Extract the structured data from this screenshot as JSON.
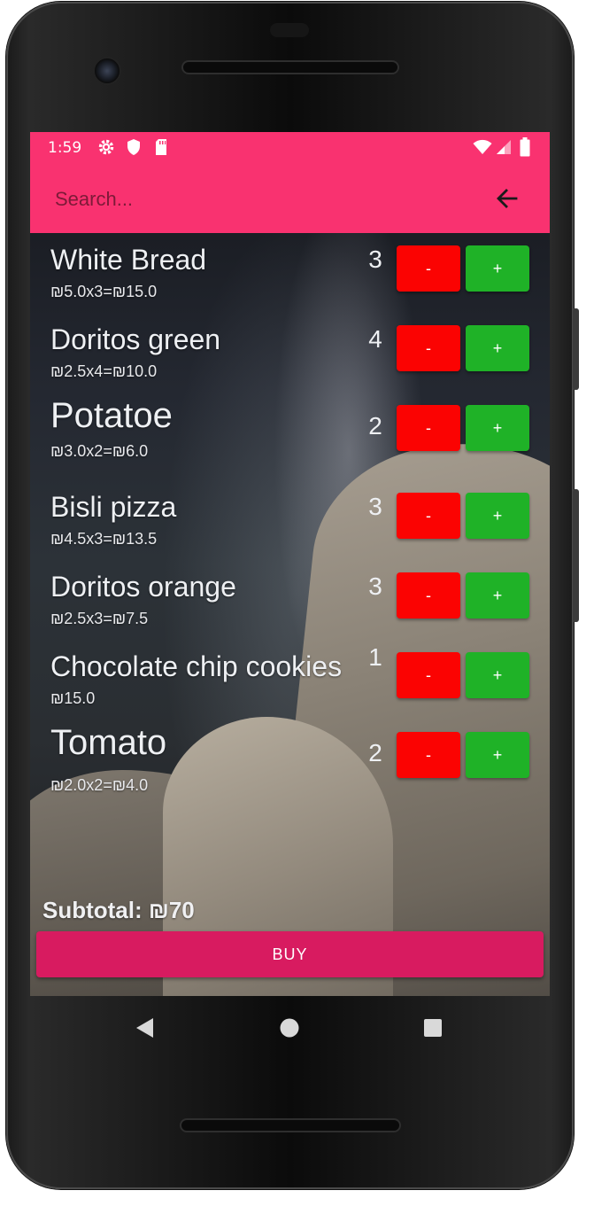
{
  "status_bar": {
    "time": "1:59",
    "icons": [
      "gear-icon",
      "shield-icon",
      "sd-card-icon",
      "wifi-icon",
      "signal-icon",
      "battery-icon"
    ]
  },
  "toolbar": {
    "search_placeholder": "Search...",
    "back_icon": "arrow-left-icon"
  },
  "cart": {
    "items": [
      {
        "name": "White Bread",
        "calc": "₪5.0x3=₪15.0",
        "qty": "3",
        "minus": "-",
        "plus": "+"
      },
      {
        "name": "Doritos green",
        "calc": "₪2.5x4=₪10.0",
        "qty": "4",
        "minus": "-",
        "plus": "+"
      },
      {
        "name": "Potatoe",
        "calc": "₪3.0x2=₪6.0",
        "qty": "2",
        "minus": "-",
        "plus": "+"
      },
      {
        "name": "Bisli pizza",
        "calc": "₪4.5x3=₪13.5",
        "qty": "3",
        "minus": "-",
        "plus": "+"
      },
      {
        "name": "Doritos orange",
        "calc": "₪2.5x3=₪7.5",
        "qty": "3",
        "minus": "-",
        "plus": "+"
      },
      {
        "name": "Chocolate chip cookies",
        "calc": "₪15.0",
        "qty": "1",
        "minus": "-",
        "plus": "+"
      },
      {
        "name": "Tomato",
        "calc": "₪2.0x2=₪4.0",
        "qty": "2",
        "minus": "-",
        "plus": "+"
      }
    ],
    "subtotal": "Subtotal: ₪70",
    "buy_label": "BUY"
  },
  "nav_bar": {
    "icons": [
      "back-triangle-icon",
      "home-circle-icon",
      "recents-square-icon"
    ]
  },
  "colors": {
    "accent": "#f93270",
    "buy": "#d81b60",
    "minus": "#fb0302",
    "plus": "#1fb227"
  }
}
